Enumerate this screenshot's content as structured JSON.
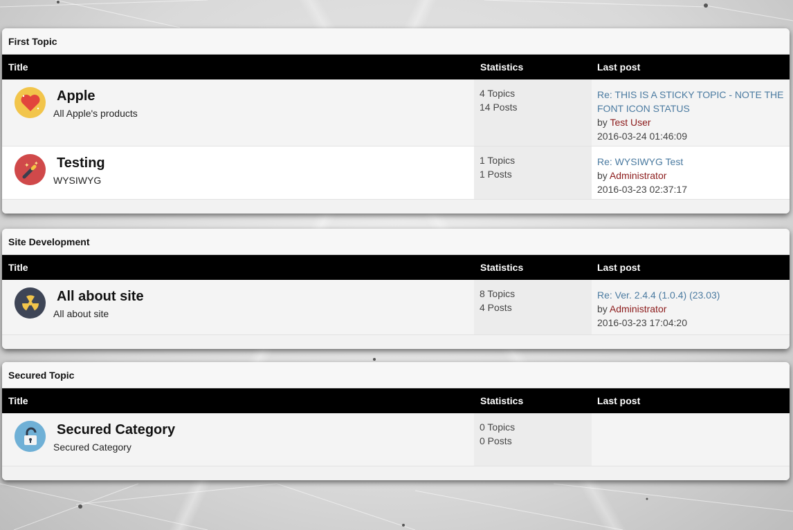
{
  "columns": {
    "title": "Title",
    "statistics": "Statistics",
    "last_post": "Last post"
  },
  "categories": [
    {
      "name": "First Topic",
      "forums": [
        {
          "name": "Apple",
          "desc": "All Apple's products",
          "icon": "heart-icon",
          "topics": "4 Topics",
          "posts": "14 Posts",
          "last_title": "Re: THIS IS A STICKY TOPIC - NOTE THE FONT ICON STATUS",
          "by": "by",
          "last_user": "Test User",
          "last_date": "2016-03-24 01:46:09"
        },
        {
          "name": "Testing",
          "desc": "WYSIWYG",
          "icon": "magic-wand-icon",
          "topics": "1 Topics",
          "posts": "1 Posts",
          "last_title": "Re: WYSIWYG Test",
          "by": "by",
          "last_user": "Administrator",
          "last_date": "2016-03-23 02:37:17"
        }
      ]
    },
    {
      "name": "Site Development",
      "forums": [
        {
          "name": "All about site",
          "desc": "All about site",
          "icon": "radiation-icon",
          "topics": "8 Topics",
          "posts": "4 Posts",
          "last_title": "Re: Ver. 2.4.4 (1.0.4) (23.03)",
          "by": "by",
          "last_user": "Administrator",
          "last_date": "2016-03-23 17:04:20"
        }
      ]
    },
    {
      "name": "Secured Topic",
      "forums": [
        {
          "name": "Secured Category",
          "desc": "Secured Category",
          "icon": "lock-icon",
          "topics": "0 Topics",
          "posts": "0 Posts"
        }
      ]
    }
  ],
  "colors": {
    "link": "#4a7aa0",
    "user": "#8b1a1a",
    "header_bg": "#000000"
  }
}
